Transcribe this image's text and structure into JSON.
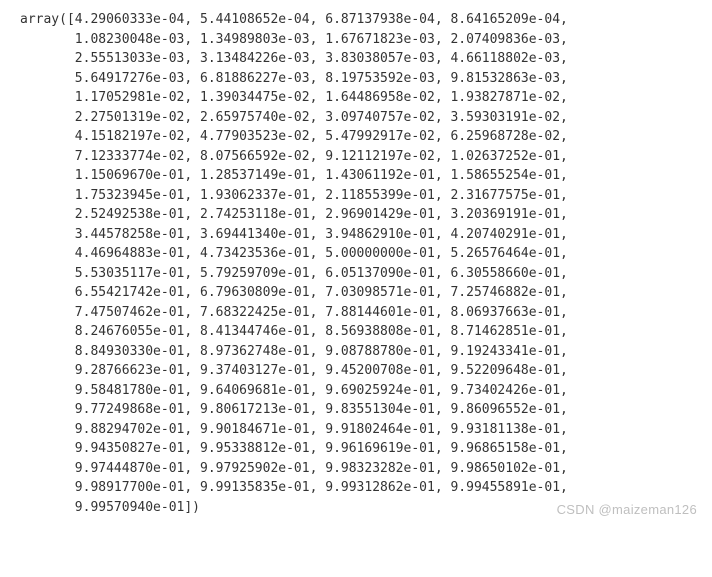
{
  "array_output": {
    "prefix": "array([",
    "suffix": "])",
    "values": [
      "4.29060333e-04",
      "5.44108652e-04",
      "6.87137938e-04",
      "8.64165209e-04",
      "1.08230048e-03",
      "1.34989803e-03",
      "1.67671823e-03",
      "2.07409836e-03",
      "2.55513033e-03",
      "3.13484226e-03",
      "3.83038057e-03",
      "4.66118802e-03",
      "5.64917276e-03",
      "6.81886227e-03",
      "8.19753592e-03",
      "9.81532863e-03",
      "1.17052981e-02",
      "1.39034475e-02",
      "1.64486958e-02",
      "1.93827871e-02",
      "2.27501319e-02",
      "2.65975740e-02",
      "3.09740757e-02",
      "3.59303191e-02",
      "4.15182197e-02",
      "4.77903523e-02",
      "5.47992917e-02",
      "6.25968728e-02",
      "7.12333774e-02",
      "8.07566592e-02",
      "9.12112197e-02",
      "1.02637252e-01",
      "1.15069670e-01",
      "1.28537149e-01",
      "1.43061192e-01",
      "1.58655254e-01",
      "1.75323945e-01",
      "1.93062337e-01",
      "2.11855399e-01",
      "2.31677575e-01",
      "2.52492538e-01",
      "2.74253118e-01",
      "2.96901429e-01",
      "3.20369191e-01",
      "3.44578258e-01",
      "3.69441340e-01",
      "3.94862910e-01",
      "4.20740291e-01",
      "4.46964883e-01",
      "4.73423536e-01",
      "5.00000000e-01",
      "5.26576464e-01",
      "5.53035117e-01",
      "5.79259709e-01",
      "6.05137090e-01",
      "6.30558660e-01",
      "6.55421742e-01",
      "6.79630809e-01",
      "7.03098571e-01",
      "7.25746882e-01",
      "7.47507462e-01",
      "7.68322425e-01",
      "7.88144601e-01",
      "8.06937663e-01",
      "8.24676055e-01",
      "8.41344746e-01",
      "8.56938808e-01",
      "8.71462851e-01",
      "8.84930330e-01",
      "8.97362748e-01",
      "9.08788780e-01",
      "9.19243341e-01",
      "9.28766623e-01",
      "9.37403127e-01",
      "9.45200708e-01",
      "9.52209648e-01",
      "9.58481780e-01",
      "9.64069681e-01",
      "9.69025924e-01",
      "9.73402426e-01",
      "9.77249868e-01",
      "9.80617213e-01",
      "9.83551304e-01",
      "9.86096552e-01",
      "9.88294702e-01",
      "9.90184671e-01",
      "9.91802464e-01",
      "9.93181138e-01",
      "9.94350827e-01",
      "9.95338812e-01",
      "9.96169619e-01",
      "9.96865158e-01",
      "9.97444870e-01",
      "9.97925902e-01",
      "9.98323282e-01",
      "9.98650102e-01",
      "9.98917700e-01",
      "9.99135835e-01",
      "9.99312862e-01",
      "9.99455891e-01",
      "9.99570940e-01"
    ]
  },
  "watermark": "CSDN @maizeman126"
}
